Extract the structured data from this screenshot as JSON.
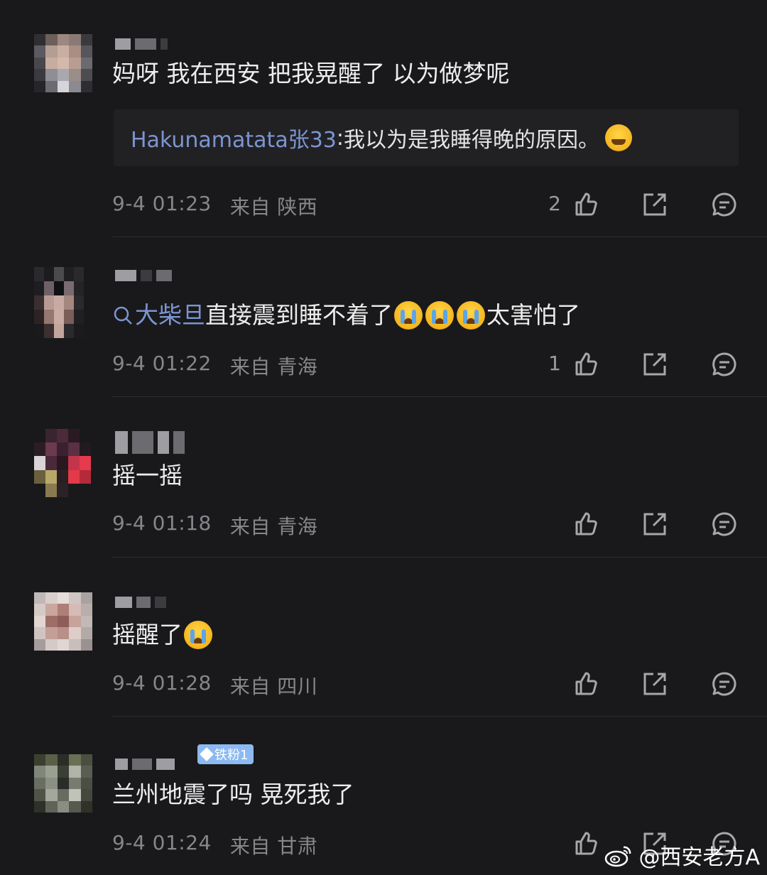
{
  "comments": [
    {
      "text_before": "妈呀 我在西安 把我晃醒了 以为做梦呢",
      "reply": {
        "user": "Hakunamatata张33",
        "sep": ": ",
        "text": "我以为是我睡得晚的原因。"
      },
      "date": "9-4 01:23",
      "from_label": "来自",
      "location": "陕西",
      "likes": "2"
    },
    {
      "link_icon": "search-icon",
      "link_text": "大柴旦",
      "text_before": "直接震到睡不着了",
      "text_after": "太害怕了",
      "date": "9-4 01:22",
      "from_label": "来自",
      "location": "青海",
      "likes": "1"
    },
    {
      "text_before": "摇一摇",
      "date": "9-4 01:18",
      "from_label": "来自",
      "location": "青海",
      "likes": ""
    },
    {
      "text_before": "摇醒了",
      "date": "9-4 01:28",
      "from_label": "来自",
      "location": "四川",
      "likes": ""
    },
    {
      "badge": "铁粉1",
      "text_before": "兰州地震了吗 晃死我了",
      "date": "9-4 01:24",
      "from_label": "来自",
      "location": "甘肃",
      "likes": ""
    }
  ],
  "icons": {
    "like": "thumbs-up-icon",
    "share": "share-icon",
    "comment": "comment-icon",
    "emoji_cry": "crying-emoji",
    "emoji_smile": "smile-emoji"
  },
  "colors": {
    "background": "#19191b",
    "link": "#7c95d1",
    "meta": "#86868b",
    "badge": "#8cb9f2"
  },
  "watermark": {
    "text": "@西安老方A"
  }
}
